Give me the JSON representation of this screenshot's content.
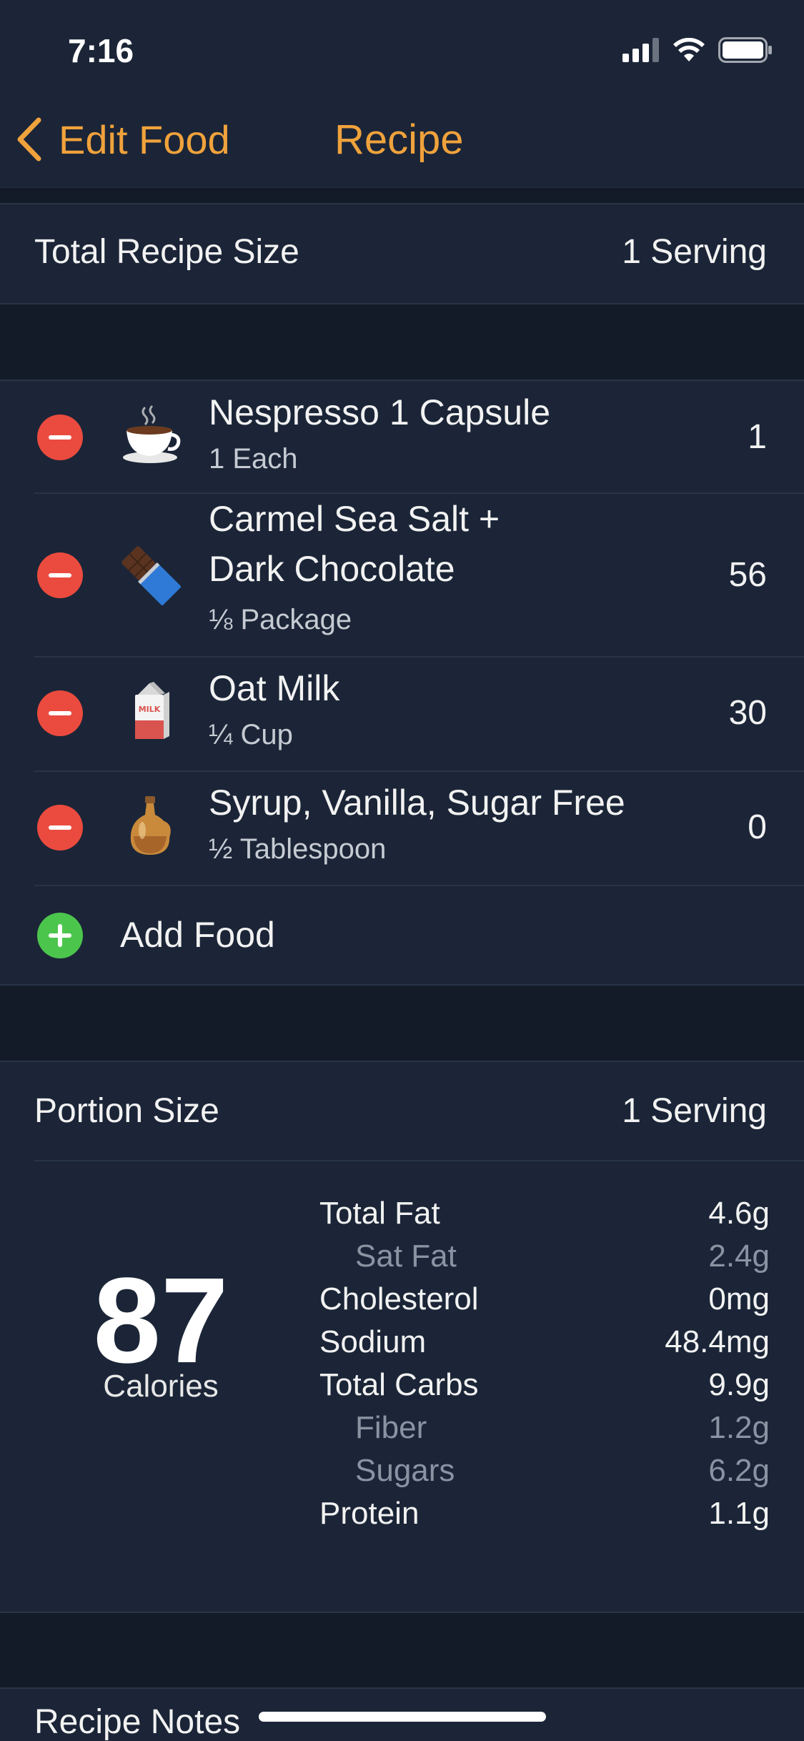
{
  "status": {
    "time": "7:16"
  },
  "nav": {
    "back_label": "Edit Food",
    "title": "Recipe"
  },
  "recipe_size": {
    "label": "Total Recipe Size",
    "value": "1 Serving"
  },
  "ingredients": [
    {
      "name_line1": "Nespresso 1 Capsule",
      "name_line2": "",
      "serving": "1 Each",
      "calories": "1",
      "icon": "coffee-cup-icon"
    },
    {
      "name_line1": "Carmel Sea Salt +",
      "name_line2": "Dark Chocolate",
      "serving": "⅛ Package",
      "calories": "56",
      "icon": "chocolate-bar-icon"
    },
    {
      "name_line1": "Oat Milk",
      "name_line2": "",
      "serving": "¼ Cup",
      "calories": "30",
      "icon": "milk-carton-icon"
    },
    {
      "name_line1": "Syrup, Vanilla, Sugar Free",
      "name_line2": "",
      "serving": "½ Tablespoon",
      "calories": "0",
      "icon": "syrup-bottle-icon"
    }
  ],
  "add_food": {
    "label": "Add Food"
  },
  "portion": {
    "label": "Portion Size",
    "value": "1 Serving"
  },
  "nutrition": {
    "calories": "87",
    "calories_label": "Calories",
    "rows": [
      {
        "label": "Total Fat",
        "value": "4.6g"
      },
      {
        "label": "Sat Fat",
        "value": "2.4g"
      },
      {
        "label": "Cholesterol",
        "value": "0mg"
      },
      {
        "label": "Sodium",
        "value": "48.4mg"
      },
      {
        "label": "Total Carbs",
        "value": "9.9g"
      },
      {
        "label": "Fiber",
        "value": "1.2g"
      },
      {
        "label": "Sugars",
        "value": "6.2g"
      },
      {
        "label": "Protein",
        "value": "1.1g"
      }
    ]
  },
  "notes": {
    "label": "Recipe Notes"
  },
  "colors": {
    "accent": "#f0a23c",
    "delete": "#eb4b3f",
    "add": "#4cc54d",
    "background": "#131b28",
    "cell": "#1b2537"
  }
}
